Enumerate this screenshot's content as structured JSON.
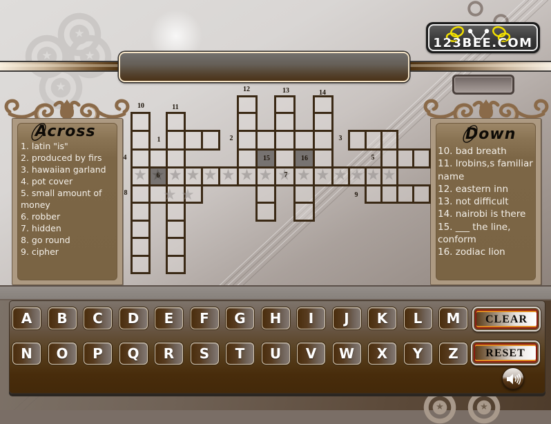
{
  "logo": {
    "text": "123BEE.COM"
  },
  "across": {
    "heading": "Across",
    "clues": [
      "1. latin \"is\"",
      "2. produced by firs",
      "3. hawaiian garland",
      "4. pot cover",
      "5. small amount of money",
      "6. robber",
      "7. hidden",
      "8. go round",
      "9. cipher"
    ]
  },
  "down": {
    "heading": "Down",
    "clues": [
      "10. bad breath",
      "11. lrobins,s familiar name",
      "12. eastern inn",
      "13. not difficult",
      "14. nairobi is there",
      "15. ___ the line, conform",
      "16. zodiac lion"
    ]
  },
  "grid": {
    "labels": [
      "1",
      "2",
      "3",
      "4",
      "5",
      "6",
      "7",
      "8",
      "9",
      "10",
      "11",
      "12",
      "13",
      "14",
      "15",
      "16"
    ],
    "shaded_cell_labels": [
      "6",
      "15",
      "16"
    ],
    "letters": "empty"
  },
  "keyboard": {
    "row1": [
      "A",
      "B",
      "C",
      "D",
      "E",
      "F",
      "G",
      "H",
      "I",
      "J",
      "K",
      "L",
      "M"
    ],
    "row2": [
      "N",
      "O",
      "P",
      "Q",
      "R",
      "S",
      "T",
      "U",
      "V",
      "W",
      "X",
      "Y",
      "Z"
    ],
    "clear_label": "CLEAR",
    "reset_label": "RESET"
  },
  "sound": {
    "icon": "speaker-icon"
  },
  "colors": {
    "grid_border": "#3a2915",
    "shaded_cell": "#777371",
    "panel_text": "#f4f0e9",
    "key_face": "#4a2d0d",
    "button_border": "#8a1a10",
    "logo_wing": "#f2e000"
  }
}
